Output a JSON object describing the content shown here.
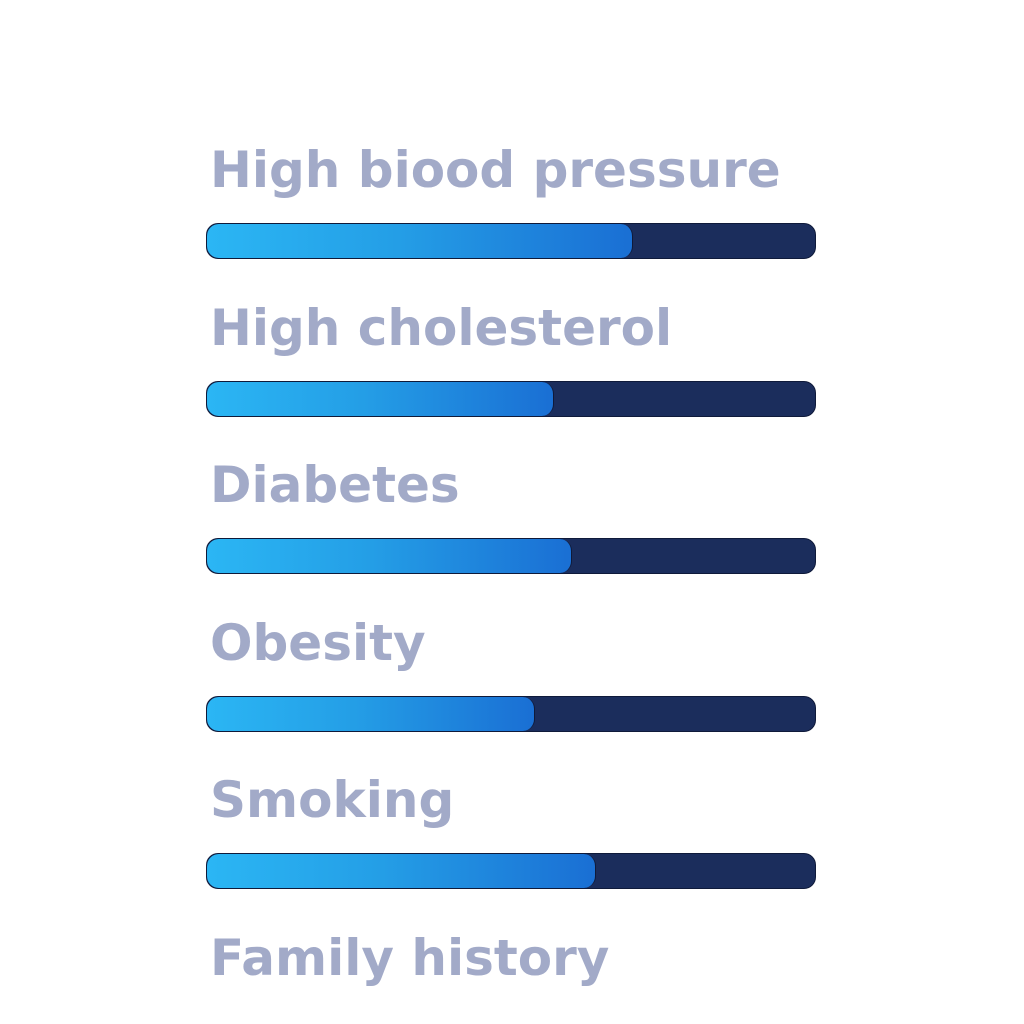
{
  "chart_data": {
    "type": "bar",
    "orientation": "horizontal",
    "title": "",
    "xlabel": "",
    "ylabel": "",
    "xlim": [
      0,
      1
    ],
    "grid": false,
    "categories": [
      "High biood pressure",
      "High cholesterol",
      "Diabetes",
      "Obesity",
      "Smoking",
      "Family history"
    ],
    "values": [
      0.7,
      0.57,
      0.6,
      0.54,
      0.64,
      null
    ],
    "colors": {
      "label_text": "#a2aac8",
      "bar_fill_start": "#2bb6f4",
      "bar_fill_end": "#1a6fd4",
      "bar_track": "#1b2d5c"
    }
  }
}
